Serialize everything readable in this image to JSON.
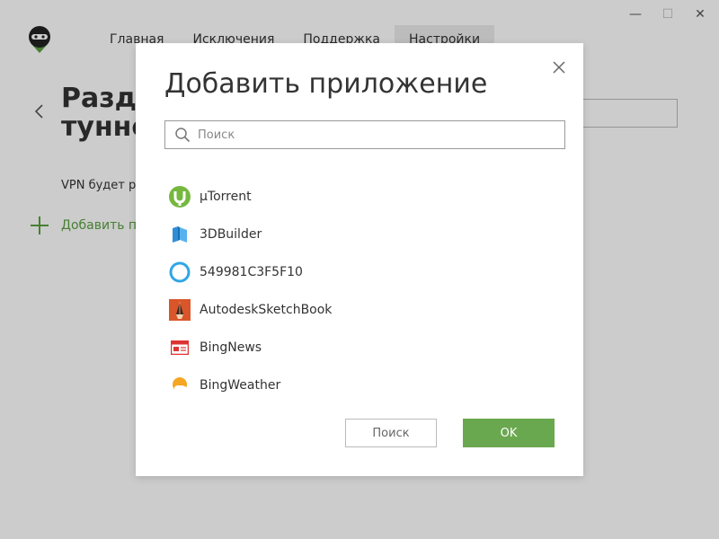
{
  "window": {
    "controls": [
      "minimize",
      "maximize",
      "close"
    ],
    "close_glyph": "✕",
    "minimize_glyph": "—",
    "maximize_glyph": "☐"
  },
  "nav": {
    "items": [
      {
        "label": "Главная",
        "active": false
      },
      {
        "label": "Исключения",
        "active": false
      },
      {
        "label": "Поддержка",
        "active": false
      },
      {
        "label": "Настройки",
        "active": true
      }
    ]
  },
  "page": {
    "title_line1": "Разде",
    "title_line2": "тунне",
    "description": "VPN будет ра",
    "add_label": "Добавить п"
  },
  "dialog": {
    "title": "Добавить приложение",
    "search_placeholder": "Поиск",
    "apps": [
      {
        "name": "µTorrent",
        "icon": "utorrent-icon"
      },
      {
        "name": "3DBuilder",
        "icon": "3dbuilder-icon"
      },
      {
        "name": "549981C3F5F10",
        "icon": "cortana-icon"
      },
      {
        "name": "AutodeskSketchBook",
        "icon": "sketchbook-icon"
      },
      {
        "name": "BingNews",
        "icon": "bingnews-icon"
      },
      {
        "name": "BingWeather",
        "icon": "bingweather-icon"
      }
    ],
    "secondary_button": "Поиск",
    "ok_button": "OK"
  },
  "colors": {
    "accent_green": "#6aa84f",
    "link_green": "#59a13f"
  }
}
